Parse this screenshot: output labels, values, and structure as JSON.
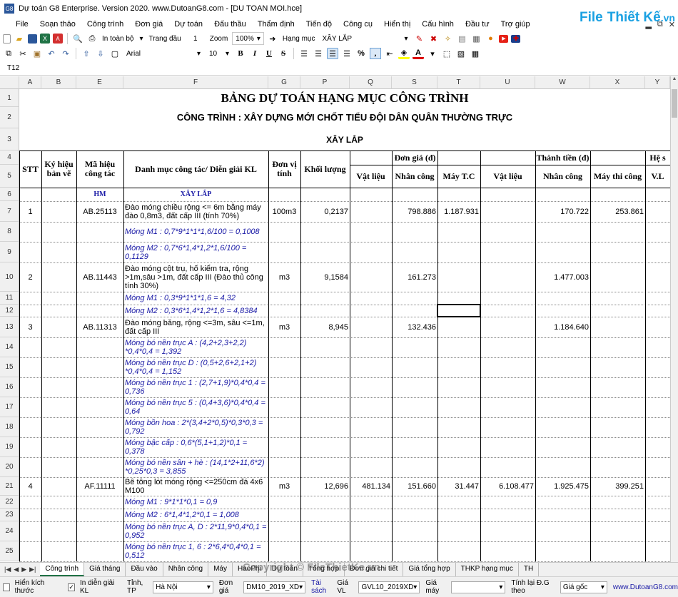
{
  "window": {
    "title": "Dự toán G8 Enterprise. Version 2020.  www.DutoanG8.com  - [DU TOAN MOI.hce]",
    "app_icon_text": "G8",
    "logo": {
      "part1": "File",
      "part2": "Thiết Kế",
      "part3": ".vn"
    },
    "controls": [
      "▂",
      "⧉",
      "✕"
    ]
  },
  "menu": [
    "File",
    "Soạn thảo",
    "Công trình",
    "Đơn giá",
    "Dự toán",
    "Đấu thầu",
    "Thẩm định",
    "Tiến độ",
    "Công cụ",
    "Hiển thị",
    "Cấu hình",
    "Đầu tư",
    "Trợ giúp"
  ],
  "toolbar1": {
    "print_label": "In toàn bộ",
    "page_label": "Trang đầu",
    "page_value": "1",
    "zoom_label": "Zoom",
    "zoom_value": "100%",
    "category_label": "Hạng mục",
    "category_value": "XÂY LẮP"
  },
  "toolbar2": {
    "font_name": "Arial",
    "font_size": "10",
    "bold": "B",
    "italic": "I",
    "underline": "U",
    "strike": "S",
    "percent": "%",
    "comma": ","
  },
  "name_box": "T12",
  "columns": [
    "A",
    "B",
    "E",
    "F",
    "G",
    "P",
    "Q",
    "S",
    "T",
    "U",
    "W",
    "X",
    "Y"
  ],
  "sheet": {
    "title": "BẢNG DỰ TOÁN HẠNG MỤC CÔNG TRÌNH",
    "project": "CÔNG TRÌNH : XÂY DỰNG MỚI CHỐT TIỂU ĐỘI DÂN QUÂN THƯỜNG TRỰC",
    "section": "XÂY LẮP",
    "headers": {
      "stt": "STT",
      "ky_hieu": "Ký hiệu bản vẽ",
      "ma_hieu": "Mã hiệu công tác",
      "danh_muc": "Danh mục công tác/ Diễn giải KL",
      "don_vi": "Đơn vị tính",
      "khoi_luong": "Khối lượng",
      "don_gia": "Đơn giá (đ)",
      "thanh_tien": "Thành tiền (đ)",
      "he_so": "Hệ s",
      "vat_lieu": "Vật liệu",
      "nhan_cong": "Nhân công",
      "may_tc": "Máy T.C",
      "vat_lieu2": "Vật liệu",
      "nhan_cong2": "Nhân công",
      "may_thi_cong": "Máy thi công",
      "vl": "V.L"
    },
    "row6": {
      "hm": "HM",
      "xl": "XÂY LẮP"
    },
    "rows": [
      {
        "n": "7",
        "stt": "1",
        "ma": "AB.25113",
        "desc": "Đào móng chiều rộng <= 6m bằng máy đào 0,8m3, đất cấp III (tính 70%)",
        "dv": "100m3",
        "kl": "0,2137",
        "vl": "",
        "nc": "798.886",
        "m": "1.187.931",
        "tvl": "",
        "tnc": "170.722",
        "tm": "253.861",
        "blue": false
      },
      {
        "n": "8",
        "desc": "Móng M1 : 0,7*9*1*1*1,6/100 = 0,1008",
        "blue": true
      },
      {
        "n": "9",
        "desc": "Móng M2 : 0,7*6*1,4*1,2*1,6/100 = 0,1129",
        "blue": true
      },
      {
        "n": "10",
        "stt": "2",
        "ma": "AB.11443",
        "desc": "Đào móng cột trụ, hố kiểm tra, rộng >1m,sâu >1m, đất cấp III (Đào thủ công tính 30%)",
        "dv": "m3",
        "kl": "9,1584",
        "vl": "",
        "nc": "161.273",
        "m": "",
        "tvl": "",
        "tnc": "1.477.003",
        "tm": "",
        "blue": false
      },
      {
        "n": "11",
        "desc": "Móng M1 : 0,3*9*1*1*1,6 = 4,32",
        "blue": true
      },
      {
        "n": "12",
        "desc": "Móng M2 : 0,3*6*1,4*1,2*1,6 = 4,8384",
        "blue": true
      },
      {
        "n": "13",
        "stt": "3",
        "ma": "AB.11313",
        "desc": "Đào móng băng, rộng <=3m, sâu <=1m, đất cấp III",
        "dv": "m3",
        "kl": "8,945",
        "vl": "",
        "nc": "132.436",
        "m": "",
        "tvl": "",
        "tnc": "1.184.640",
        "tm": "",
        "blue": false
      },
      {
        "n": "14",
        "desc": "Móng bó nền trục A : (4,2+2,3+2,2) *0,4*0,4 = 1,392",
        "blue": true
      },
      {
        "n": "15",
        "desc": "Móng bó nền trục D : (0,5+2,6+2,1+2) *0,4*0,4 = 1,152",
        "blue": true
      },
      {
        "n": "16",
        "desc": "Móng bó nền trục 1 : (2,7+1,9)*0,4*0,4 = 0,736",
        "blue": true
      },
      {
        "n": "17",
        "desc": "Móng bó nền trục 5 : (0,4+3,6)*0,4*0,4 = 0,64",
        "blue": true
      },
      {
        "n": "18",
        "desc": "Móng bồn hoa : 2*(3,4+2*0,5)*0,3*0,3 = 0,792",
        "blue": true
      },
      {
        "n": "19",
        "desc": "Móng bậc cấp : 0,6*(5,1+1,2)*0,1 = 0,378",
        "blue": true
      },
      {
        "n": "20",
        "desc": "Móng bó nền sân + hè : (14,1*2+11,6*2) *0,25*0,3 = 3,855",
        "blue": true
      },
      {
        "n": "21",
        "stt": "4",
        "ma": "AF.11111",
        "desc": "Bê tông lót móng rộng <=250cm đá 4x6 M100",
        "dv": "m3",
        "kl": "12,696",
        "vl": "481.134",
        "nc": "151.660",
        "m": "31.447",
        "tvl": "6.108.477",
        "tnc": "1.925.475",
        "tm": "399.251",
        "blue": false
      },
      {
        "n": "22",
        "desc": "Móng M1 : 9*1*1*0,1 = 0,9",
        "blue": true
      },
      {
        "n": "23",
        "desc": "Móng M2 : 6*1,4*1,2*0,1 = 1,008",
        "blue": true
      },
      {
        "n": "24",
        "desc": "Móng bó nền trục A, D : 2*11,9*0,4*0,1 = 0,952",
        "blue": true
      },
      {
        "n": "25",
        "desc": "Móng bó nền trục 1, 6 : 2*6,4*0,4*0,1 = 0,512",
        "blue": true
      }
    ]
  },
  "tabs": [
    "Công trình",
    "Giá tháng",
    "Đầu vào",
    "Nhân công",
    "Máy",
    "HaoPhi",
    "Dự toán",
    "Tổng hợp",
    "Đơn giá chi tiết",
    "Giá tổng hợp",
    "THKP hạng mục",
    "TH"
  ],
  "tab_nav": [
    "|◀",
    "◀",
    "▶",
    "▶|"
  ],
  "watermark": "Copyright © FileThietKe.vn",
  "status": {
    "show_size": "Hiển kích thước",
    "show_kl": "In diễn giải KL",
    "province_label": "Tỉnh, TP",
    "province": "Hà Nội",
    "dongia_label": "Đơn giá",
    "dongia": "DM10_2019_XD",
    "book": "Tài sách",
    "giavl_label": "Giá VL",
    "giavl": "GVL10_2019XD",
    "giamay_label": "Giá máy",
    "giamay": "",
    "tinhlai_label": "Tính lại Đ.G theo",
    "tinhlai": "Giá gốc",
    "website": "www.DutoanG8.com"
  }
}
